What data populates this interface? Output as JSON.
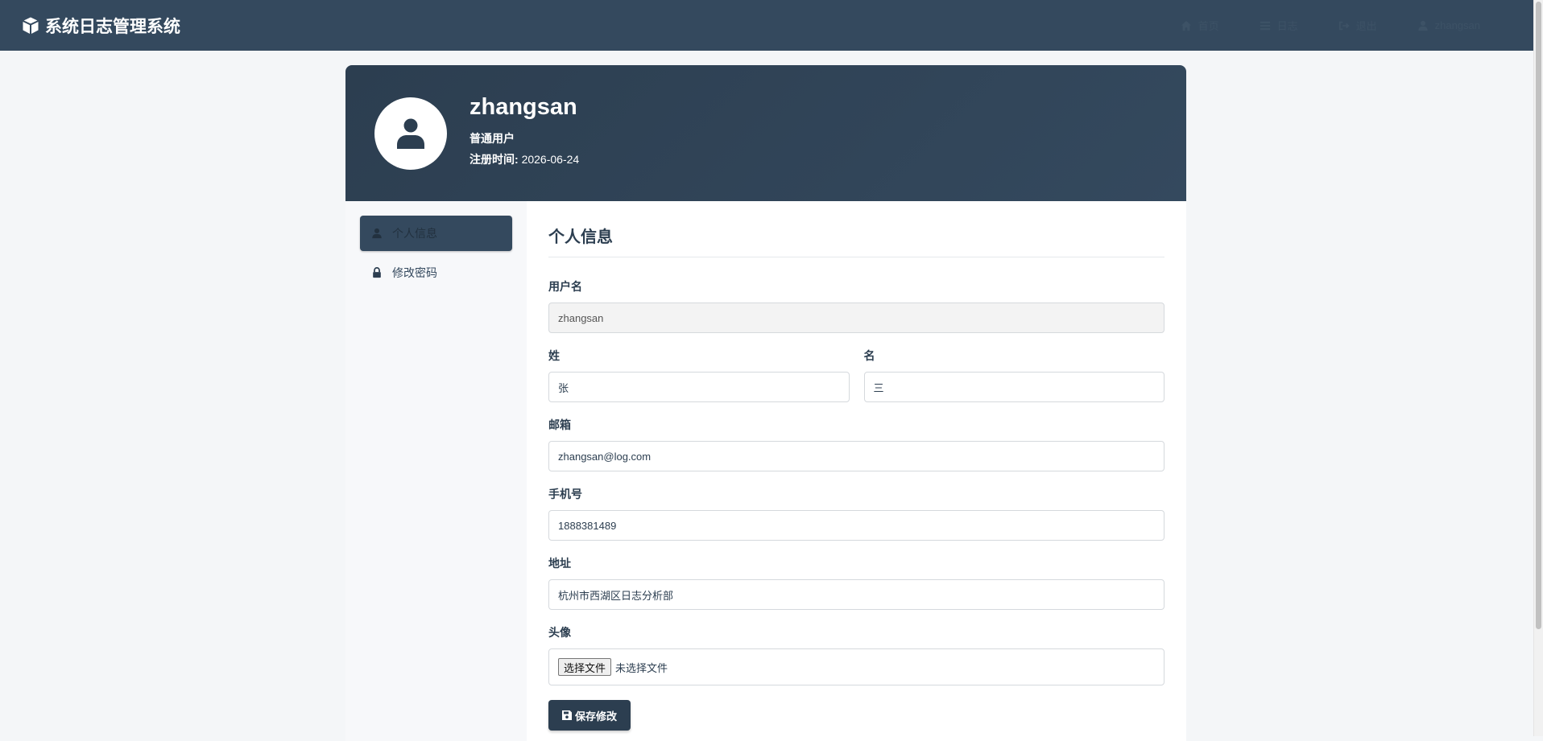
{
  "navbar": {
    "brand": "系统日志管理系统",
    "links": [
      {
        "label": "首页",
        "icon": "home-icon"
      },
      {
        "label": "日志",
        "icon": "list-icon"
      },
      {
        "label": "退出",
        "icon": "logout-icon"
      },
      {
        "label": "zhangsan",
        "icon": "user-icon"
      }
    ]
  },
  "profile": {
    "username": "zhangsan",
    "role": "普通用户",
    "reg_label": "注册时间:",
    "reg_date": "2026-06-24"
  },
  "menu": {
    "items": [
      {
        "label": "个人信息",
        "icon": "user-icon",
        "active": true
      },
      {
        "label": "修改密码",
        "icon": "lock-icon",
        "active": false
      }
    ]
  },
  "form": {
    "title": "个人信息",
    "username_label": "用户名",
    "username_value": "zhangsan",
    "lastname_label": "姓",
    "lastname_value": "张",
    "firstname_label": "名",
    "firstname_value": "三",
    "email_label": "邮箱",
    "email_value": "zhangsan@log.com",
    "phone_label": "手机号",
    "phone_value": "1888381489",
    "address_label": "地址",
    "address_value": "杭州市西湖区日志分析部",
    "avatar_label": "头像",
    "file_button": "选择文件",
    "file_status": "未选择文件",
    "save_label": "保存修改"
  },
  "colors": {
    "navbar": "#34495e",
    "header": "#2c3e50",
    "primary_button": "#2c3e50",
    "page_bg": "#f4f6f8"
  }
}
